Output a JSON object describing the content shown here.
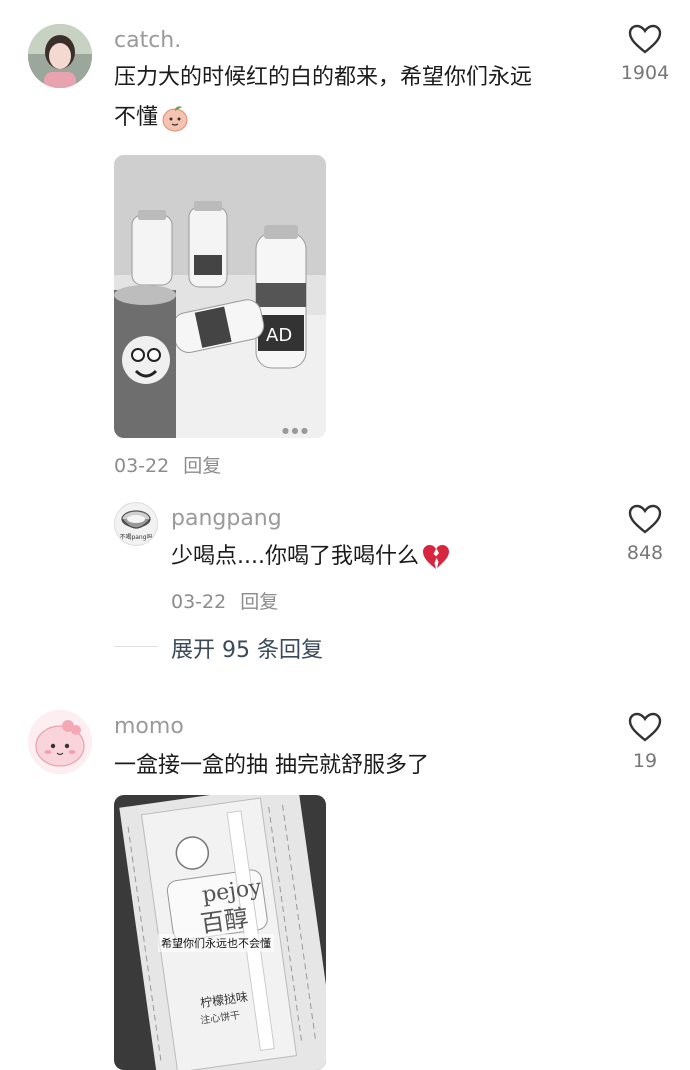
{
  "comments": [
    {
      "username": "catch.",
      "text_line1": "压力大的时候红的白的都来，希望你们永远",
      "text_line2": "不懂",
      "likes": "1904",
      "date": "03-22",
      "reply_label": "回复",
      "avatar_icon": "girl-portrait-avatar",
      "image_icon": "bottles-and-can-photo"
    },
    {
      "username": "pangpang",
      "text": "少喝点....你喝了我喝什么",
      "likes": "848",
      "date": "03-22",
      "reply_label": "回复",
      "avatar_icon": "bowl-avatar",
      "avatar_caption": "不喝pang吗"
    },
    {
      "username": "momo",
      "text": "一盒接一盒的抽 抽完就舒服多了",
      "likes": "19",
      "avatar_icon": "pink-cartoon-avatar",
      "image_icon": "snack-package-photo",
      "image_overlay": "希望你们永远也不会懂",
      "package_brand": "pejoy",
      "package_brand_cn": "百醇",
      "package_flavor": "柠檬挞味",
      "package_type": "注心饼干"
    }
  ],
  "expand_replies": "展开 95 条回复",
  "colors": {
    "text": "#1b1b1b",
    "muted": "#9a9a9a",
    "link": "#3a4a5a"
  }
}
